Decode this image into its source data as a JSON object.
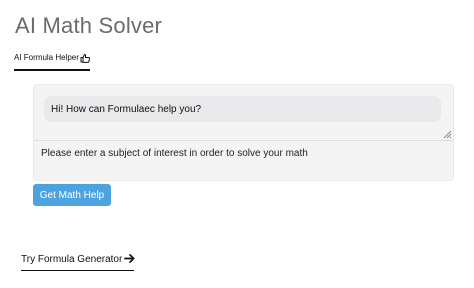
{
  "page": {
    "title": "AI Math Solver"
  },
  "tabs": [
    {
      "label": "AI Formula Helper",
      "icon": "pointing-hand-icon",
      "active": true
    }
  ],
  "chat": {
    "greeting": "Hi! How can Formulaec help you?"
  },
  "question_input": {
    "value": "",
    "placeholder": "Please enter a subject of interest in order to solve your math"
  },
  "actions": {
    "submit_label": "Get Math Help",
    "submit_color": "#4da3e0"
  },
  "footer_link": {
    "label": "Try Formula Generator",
    "icon": "arrow-right-icon"
  }
}
